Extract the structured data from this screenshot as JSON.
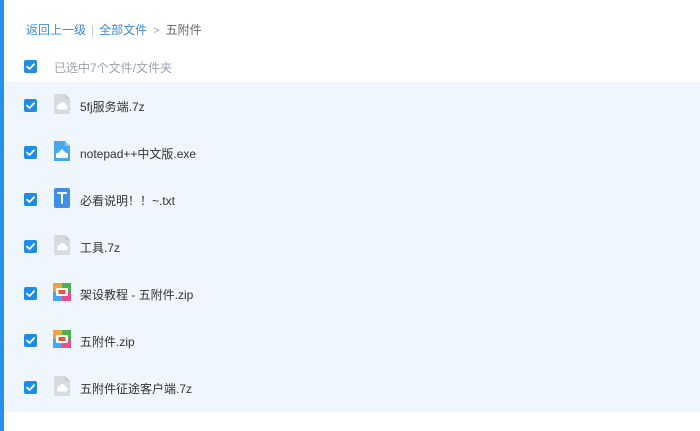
{
  "breadcrumb": {
    "back": "返回上一级",
    "separator": "|",
    "all_files": "全部文件",
    "arrow": ">",
    "current": "五附件"
  },
  "selection": {
    "summary": "已选中7个文件/文件夹"
  },
  "colors": {
    "accent": "#2b8ff0",
    "checkbox": "#1f8ce8",
    "row_background": "#f0f6fd",
    "link": "#3d8ad6"
  },
  "files": [
    {
      "name": "5fj服务端.7z",
      "icon": "archive-7z-icon",
      "checked": true
    },
    {
      "name": "notepad++中文版.exe",
      "icon": "exe-icon",
      "checked": true
    },
    {
      "name": "必看说明！！~.txt",
      "icon": "txt-icon",
      "checked": true
    },
    {
      "name": "工具.7z",
      "icon": "archive-7z-icon",
      "checked": true
    },
    {
      "name": "架设教程 - 五附件.zip",
      "icon": "zip-icon",
      "checked": true
    },
    {
      "name": "五附件.zip",
      "icon": "zip-icon",
      "checked": true
    },
    {
      "name": "五附件征途客户端.7z",
      "icon": "archive-7z-icon",
      "checked": true
    }
  ]
}
